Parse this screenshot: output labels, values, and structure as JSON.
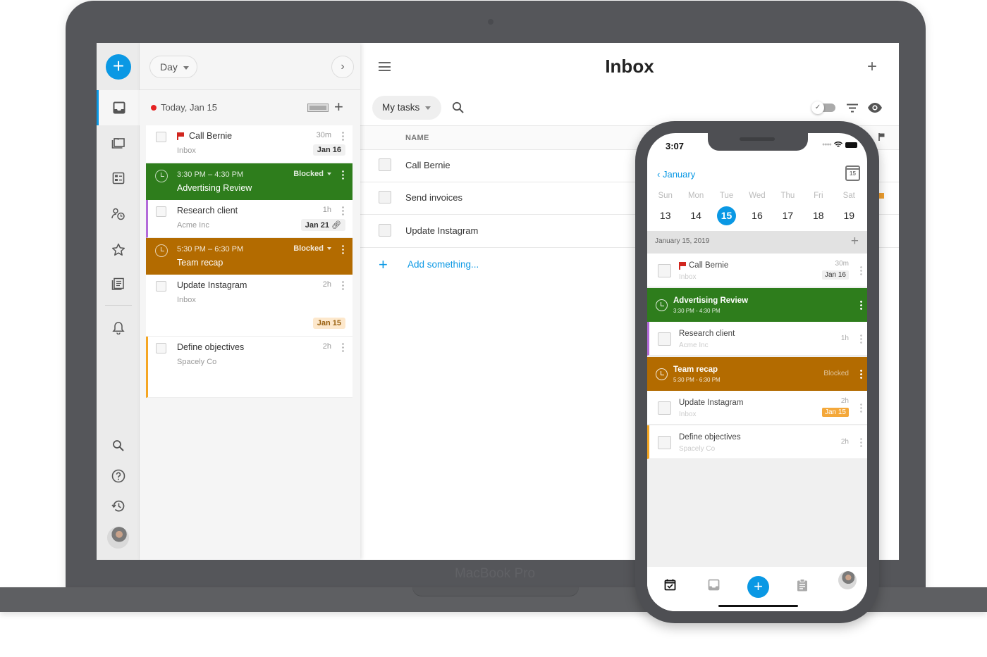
{
  "device": {
    "laptop_label": "MacBook Pro"
  },
  "rail": {
    "items": [
      {
        "icon": "inbox-icon",
        "active": true
      },
      {
        "icon": "projects-icon"
      },
      {
        "icon": "boards-icon"
      },
      {
        "icon": "people-schedule-icon"
      },
      {
        "icon": "star-icon"
      },
      {
        "icon": "notes-icon"
      },
      {
        "icon": "bell-icon"
      }
    ],
    "bottom": [
      "search-icon",
      "help-icon",
      "history-icon",
      "avatar"
    ]
  },
  "daypanel": {
    "view_label": "Day",
    "today_label": "Today, Jan 15",
    "cards": [
      {
        "type": "task",
        "title": "Call Bernie",
        "flag": true,
        "sub": "Inbox",
        "duration": "30m",
        "date": "Jan 16"
      },
      {
        "type": "event",
        "time": "3:30 PM – 4:30 PM",
        "title": "Advertising Review",
        "status": "Blocked",
        "color": "#2e7d1c"
      },
      {
        "type": "task",
        "title": "Research client",
        "sub": "Acme Inc",
        "duration": "1h",
        "date": "Jan 21",
        "accent": "#b36ad9",
        "link": true
      },
      {
        "type": "event",
        "time": "5:30 PM – 6:30 PM",
        "title": "Team recap",
        "status": "Blocked",
        "color": "#b36b00"
      },
      {
        "type": "task",
        "title": "Update Instagram",
        "sub": "Inbox",
        "duration": "2h",
        "date": "Jan 15",
        "date_style": "due"
      },
      {
        "type": "task",
        "title": "Define objectives",
        "sub": "Spacely Co",
        "duration": "2h",
        "accent": "#f5a623"
      }
    ]
  },
  "main": {
    "title": "Inbox",
    "filter_label": "My tasks",
    "column_name": "NAME",
    "rows": [
      "Call Bernie",
      "Send invoices",
      "Update Instagram"
    ],
    "add_label": "Add something..."
  },
  "phone": {
    "time": "3:07",
    "month_back": "January",
    "calendar_icon_day": "15",
    "weekdays": [
      "Sun",
      "Mon",
      "Tue",
      "Wed",
      "Thu",
      "Fri",
      "Sat"
    ],
    "days": [
      "13",
      "14",
      "15",
      "16",
      "17",
      "18",
      "19"
    ],
    "selected_day": "15",
    "date_header": "January 15, 2019",
    "items": [
      {
        "type": "task",
        "title": "Call Bernie",
        "flag": true,
        "sub": "Inbox",
        "duration": "30m",
        "date": "Jan 16"
      },
      {
        "type": "event",
        "title": "Advertising Review",
        "time": "3:30 PM - 4:30 PM",
        "color": "#2e7d1c"
      },
      {
        "type": "task",
        "title": "Research client",
        "sub": "Acme Inc",
        "duration": "1h",
        "accent": "#b36ad9"
      },
      {
        "type": "event",
        "title": "Team recap",
        "time": "5:30 PM - 6:30 PM",
        "status": "Blocked",
        "color": "#b36b00"
      },
      {
        "type": "task",
        "title": "Update Instagram",
        "sub": "Inbox",
        "duration": "2h",
        "date": "Jan 15",
        "date_style": "due"
      },
      {
        "type": "task",
        "title": "Define objectives",
        "sub": "Spacely Co",
        "duration": "2h",
        "accent": "#f5a623"
      }
    ],
    "tabs": [
      "calendar-check-icon",
      "inbox-icon",
      "add-button",
      "clipboard-icon",
      "avatar"
    ]
  },
  "colors": {
    "accent": "#0a98e4",
    "green_event": "#2e7d1c",
    "orange_event": "#b36b00",
    "purple_accent": "#b36ad9",
    "yellow_accent": "#f5a623",
    "flag_red": "#d1261f"
  }
}
